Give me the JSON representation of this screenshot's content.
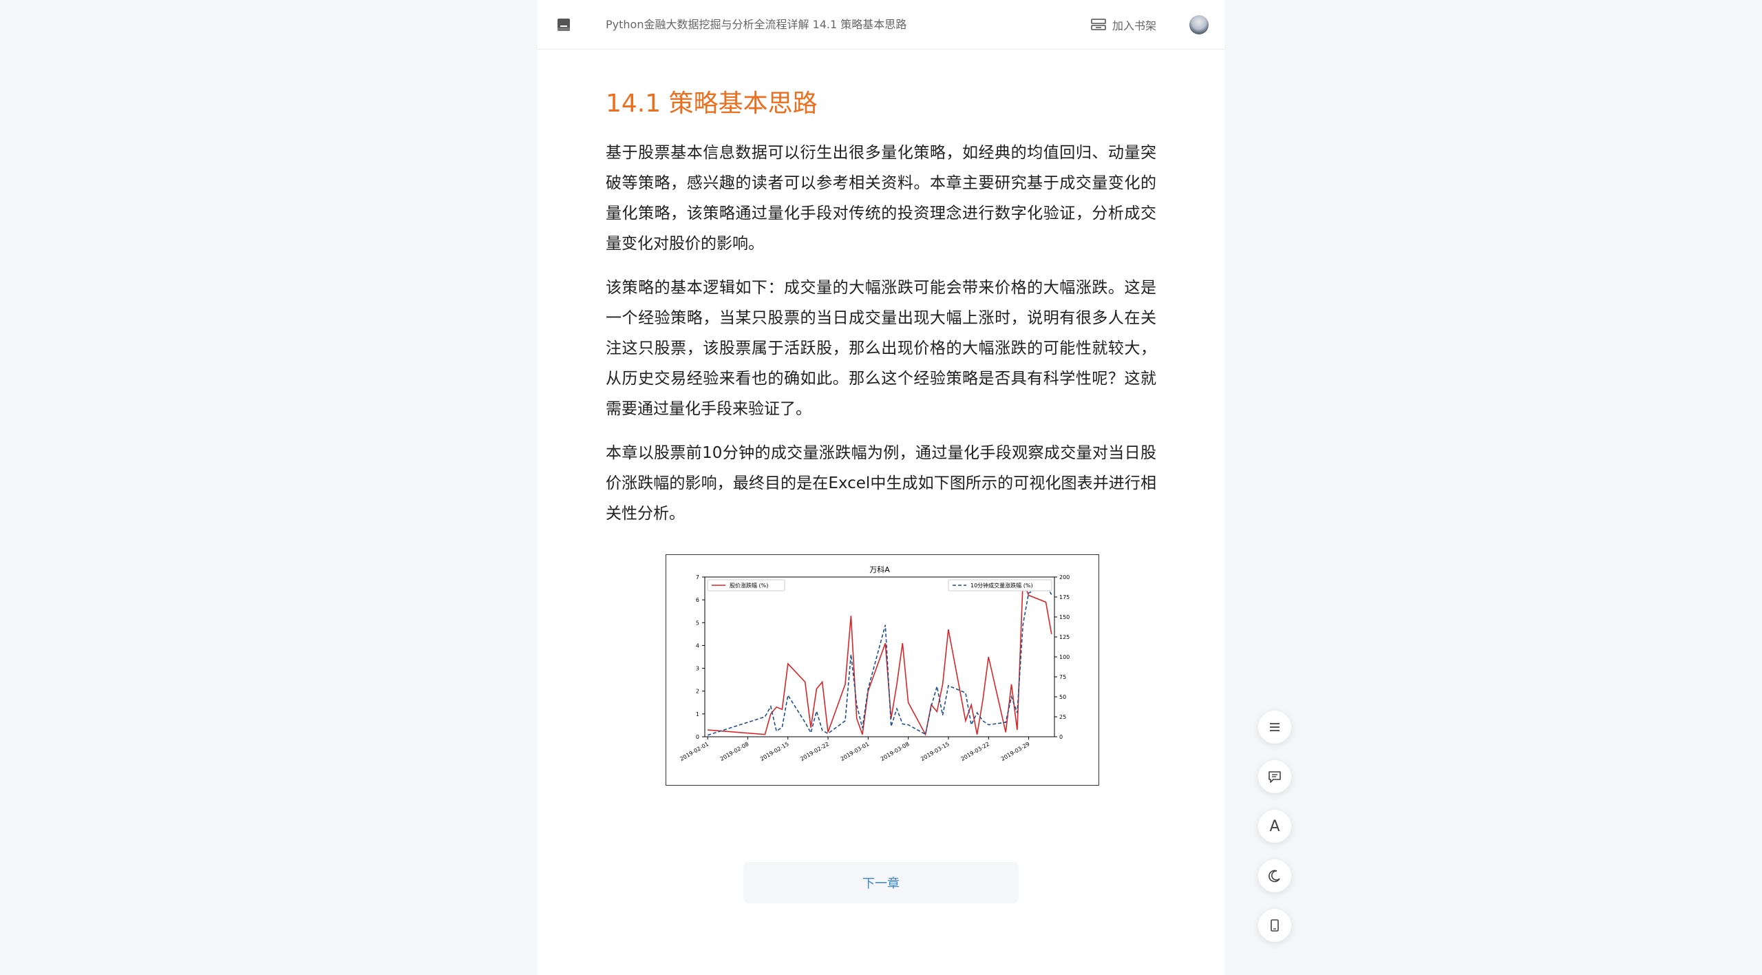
{
  "header": {
    "breadcrumb": "Python金融大数据挖掘与分析全流程详解 14.1 策略基本思路",
    "add_shelf_label": "加入书架",
    "icons": {
      "book": "book-icon",
      "shelf": "bookshelf-icon",
      "avatar": "user-avatar"
    }
  },
  "article": {
    "title": "14.1 策略基本思路",
    "paragraphs": [
      "基于股票基本信息数据可以衍生出很多量化策略，如经典的均值回归、动量突破等策略，感兴趣的读者可以参考相关资料。本章主要研究基于成交量变化的量化策略，该策略通过量化手段对传统的投资理念进行数字化验证，分析成交量变化对股价的影响。",
      "该策略的基本逻辑如下：成交量的大幅涨跌可能会带来价格的大幅涨跌。这是一个经验策略，当某只股票的当日成交量出现大幅上涨时，说明有很多人在关注这只股票，该股票属于活跃股，那么出现价格的大幅涨跌的可能性就较大，从历史交易经验来看也的确如此。那么这个经验策略是否具有科学性呢？这就需要通过量化手段来验证了。",
      "本章以股票前10分钟的成交量涨跌幅为例，通过量化手段观察成交量对当日股价涨跌幅的影响，最终目的是在Excel中生成如下图所示的可视化图表并进行相关性分析。"
    ],
    "next_chapter_label": "下一章"
  },
  "chart_data": {
    "type": "line",
    "title": "万科A",
    "x": [
      "2019-02-01",
      "2019-02-11",
      "2019-02-12",
      "2019-02-13",
      "2019-02-14",
      "2019-02-15",
      "2019-02-18",
      "2019-02-19",
      "2019-02-20",
      "2019-02-21",
      "2019-02-22",
      "2019-02-25",
      "2019-02-26",
      "2019-02-27",
      "2019-02-28",
      "2019-03-01",
      "2019-03-04",
      "2019-03-05",
      "2019-03-06",
      "2019-03-07",
      "2019-03-08",
      "2019-03-11",
      "2019-03-12",
      "2019-03-13",
      "2019-03-14",
      "2019-03-15",
      "2019-03-18",
      "2019-03-19",
      "2019-03-20",
      "2019-03-21",
      "2019-03-22",
      "2019-03-25",
      "2019-03-26",
      "2019-03-27",
      "2019-03-28",
      "2019-03-29",
      "2019-04-01",
      "2019-04-02"
    ],
    "xticks": [
      "2019-02-01",
      "2019-02-08",
      "2019-02-15",
      "2019-02-22",
      "2019-03-01",
      "2019-03-08",
      "2019-03-15",
      "2019-03-22",
      "2019-03-29"
    ],
    "series": [
      {
        "name": "股价涨跌幅 (%)",
        "axis": "left",
        "color": "#d62728",
        "style": "solid",
        "values": [
          0.3,
          0.1,
          1.0,
          1.3,
          1.2,
          3.2,
          2.4,
          0.4,
          2.1,
          2.4,
          0.2,
          2.3,
          5.3,
          0.8,
          0.1,
          2.0,
          4.1,
          0.8,
          2.3,
          4.1,
          1.5,
          0.1,
          1.4,
          1.1,
          2.3,
          4.7,
          0.7,
          1.4,
          0.1,
          1.6,
          3.5,
          0.2,
          2.3,
          0.3,
          6.8,
          6.2,
          5.9,
          4.5
        ]
      },
      {
        "name": "10分钟成交量涨跌幅 (%)",
        "axis": "right",
        "color": "#1f4e8c",
        "style": "dashed",
        "values": [
          2,
          25,
          38,
          7,
          12,
          52,
          18,
          5,
          32,
          8,
          4,
          20,
          103,
          40,
          11,
          60,
          140,
          13,
          35,
          16,
          15,
          3,
          38,
          63,
          27,
          64,
          55,
          15,
          30,
          20,
          15,
          18,
          50,
          30,
          140,
          180,
          190,
          178
        ]
      }
    ],
    "ylim_left": [
      0,
      7
    ],
    "yticks_left": [
      0,
      1,
      2,
      3,
      4,
      5,
      6,
      7
    ],
    "ylim_right": [
      0,
      200
    ],
    "yticks_right": [
      0,
      25,
      50,
      75,
      100,
      125,
      150,
      175,
      200
    ],
    "legend_left_position": "top-left",
    "legend_right_position": "top-right",
    "grid": false
  },
  "sidebar_tools": {
    "icons": [
      "toc-icon",
      "comment-icon",
      "font-icon",
      "night-mode-icon",
      "mobile-icon"
    ],
    "font_glyph": "A"
  }
}
